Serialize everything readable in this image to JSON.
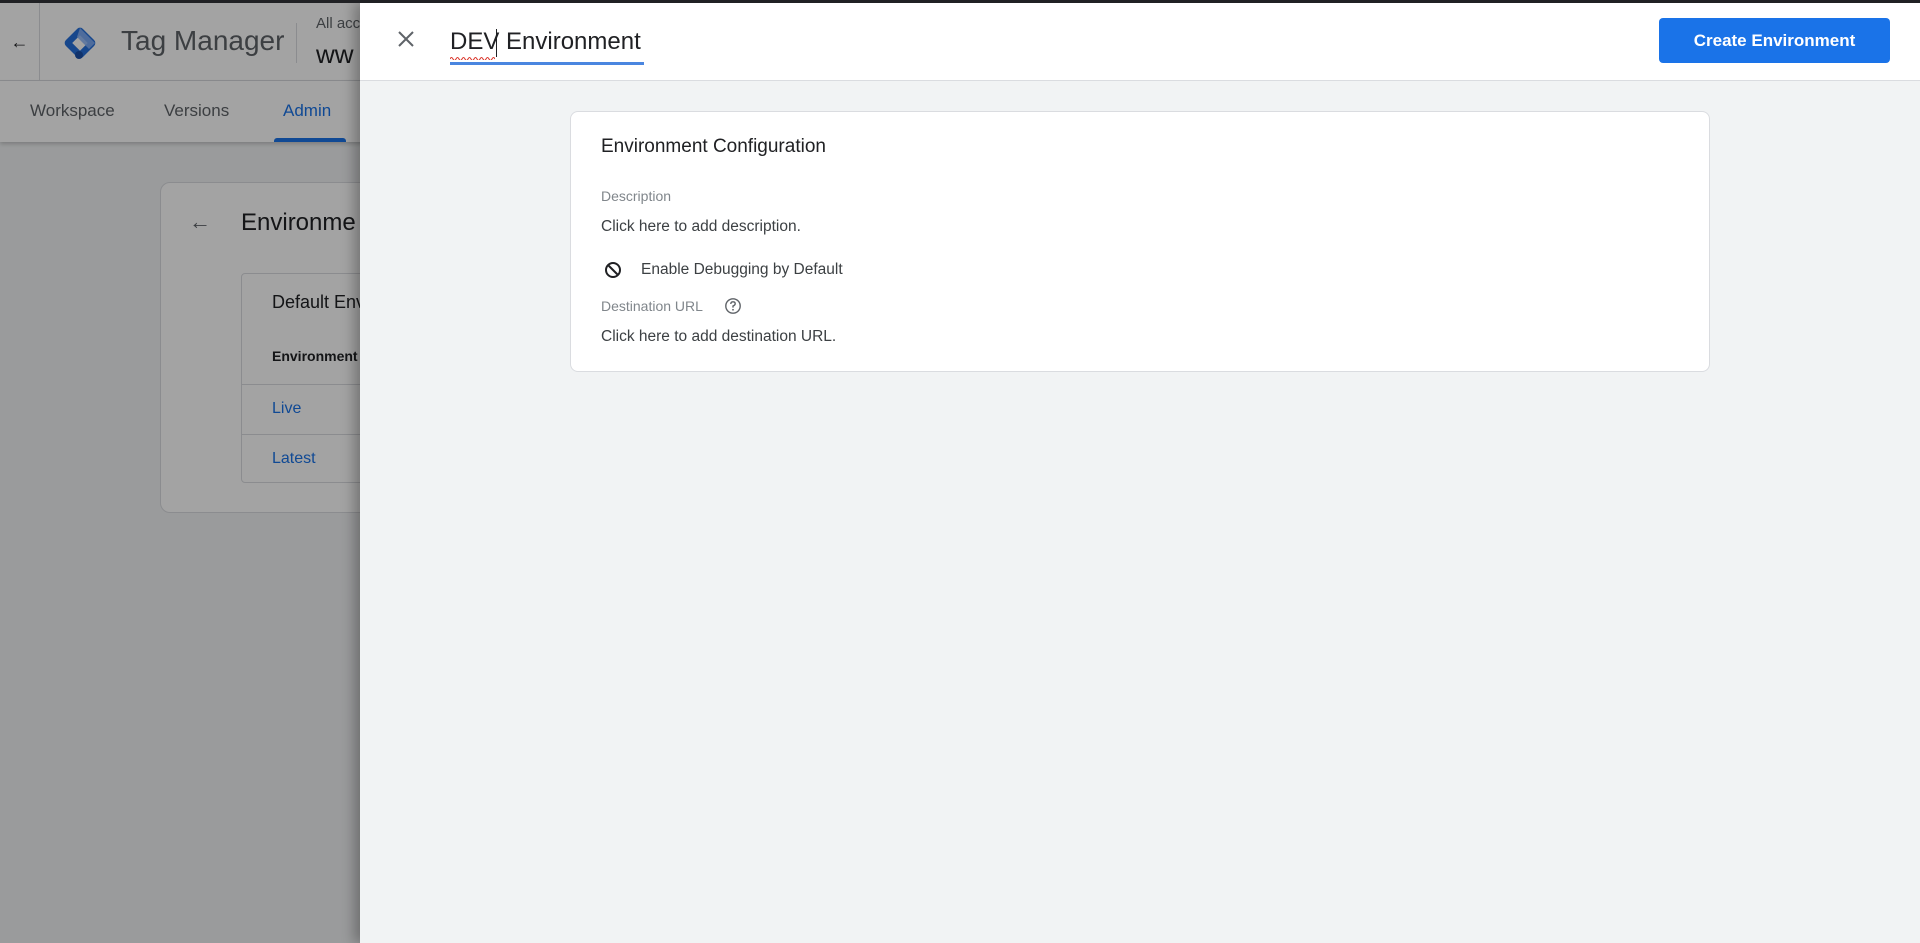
{
  "background_page": {
    "back_icon": "arrow-left-icon",
    "product_name": "Tag Manager",
    "account_label": "All acc",
    "container_name": "ww",
    "tabs": [
      {
        "label": "Workspace",
        "active": false
      },
      {
        "label": "Versions",
        "active": false
      },
      {
        "label": "Admin",
        "active": true
      }
    ],
    "card": {
      "title": "Environme",
      "table_title": "Default Env",
      "column_header": "Environment",
      "rows": [
        "Live",
        "Latest"
      ]
    }
  },
  "panel": {
    "close_icon": "close-icon",
    "name_input_value": "DEV Environment",
    "create_button_label": "Create Environment",
    "config": {
      "title": "Environment Configuration",
      "description_label": "Description",
      "description_placeholder": "Click here to add description.",
      "debug_toggle_label": "Enable Debugging by Default",
      "debug_icon": "block-icon",
      "destination_label": "Destination URL",
      "destination_help_icon": "help-icon",
      "destination_placeholder": "Click here to add destination URL."
    }
  },
  "colors": {
    "accent": "#1a73e8",
    "input_underline": "#4a86e0"
  }
}
